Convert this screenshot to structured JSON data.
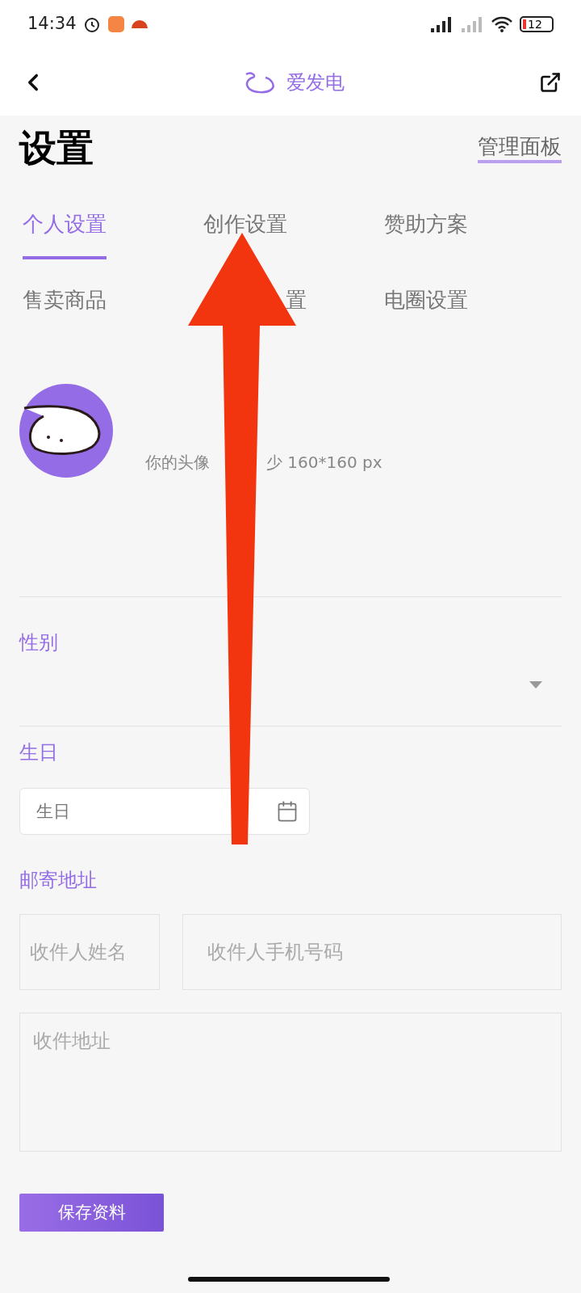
{
  "status_bar": {
    "time": "14:34",
    "battery": "12"
  },
  "header": {
    "title": "爱发电"
  },
  "page": {
    "title": "设置",
    "link": "管理面板"
  },
  "tabs": [
    {
      "label": "个人设置",
      "selected": true
    },
    {
      "label": "创作设置",
      "selected": false
    },
    {
      "label": "赞助方案",
      "selected": false
    },
    {
      "label": "售卖商品",
      "selected": false
    },
    {
      "label": "置",
      "selected": false
    },
    {
      "label": "电圈设置",
      "selected": false
    }
  ],
  "avatar_hint": [
    "你的头像",
    "少 160*160 px"
  ],
  "gender": {
    "label": "性别"
  },
  "birthday": {
    "label": "生日",
    "placeholder": "生日"
  },
  "address": {
    "label": "邮寄地址",
    "name_placeholder": "收件人姓名",
    "phone_placeholder": "收件人手机号码",
    "address_placeholder": "收件地址"
  },
  "save_button": "保存资料"
}
